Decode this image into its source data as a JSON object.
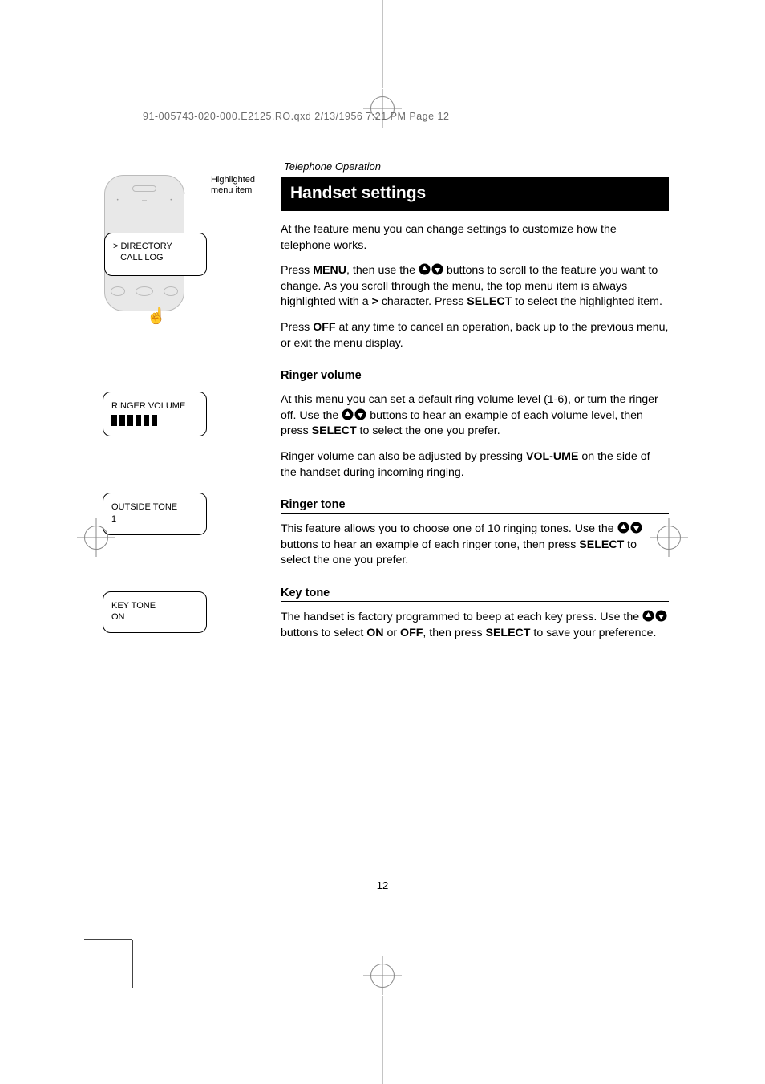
{
  "slug": "91-005743-020-000.E2125.RO.qxd  2/13/1956  7:21 PM  Page 12",
  "annot": {
    "line1": "Highlighted",
    "line2": "menu item"
  },
  "phone_screen": {
    "line1": "> DIRECTORY",
    "line2": "   CALL LOG"
  },
  "lcd_ringer": {
    "title": "RINGER VOLUME"
  },
  "lcd_outside": {
    "line1": "OUTSIDE TONE",
    "line2": "1"
  },
  "lcd_keytone": {
    "line1": "KEY TONE",
    "line2": "ON"
  },
  "section_small": "Telephone Operation",
  "title": "Handset settings",
  "intro": "At the feature menu you can change settings to customize how the telephone works.",
  "p2": {
    "a": "Press ",
    "menu": "MENU",
    "b": ", then use the ",
    "c": " buttons to scroll to the feature you want to change. As you scroll through the menu, the top menu item is always highlighted with a ",
    "gt": ">",
    "d": " character. Press ",
    "select": "SELECT",
    "e": " to select the highlighted item."
  },
  "p3": {
    "a": "Press ",
    "off": "OFF",
    "b": " at any time to cancel an operation, back up to the previous menu, or exit the menu display."
  },
  "ringer_vol": {
    "heading": "Ringer volume",
    "p1a": "At this menu you can set a default ring volume level (1-6), or turn the ringer off. Use the ",
    "p1b": " buttons to hear an example of each volume level, then press ",
    "select": "SELECT",
    "p1c": " to select the one you prefer.",
    "p2a": "Ringer volume can also be adjusted by pressing ",
    "volume": "VOL-UME",
    "p2b": " on the side of the handset during incoming ringing."
  },
  "ringer_tone": {
    "heading": "Ringer tone",
    "p1a": "This feature allows you to choose one of 10 ringing tones. Use the ",
    "p1b": " buttons to hear an example of each ringer tone, then press ",
    "select": "SELECT",
    "p1c": " to select the one you prefer."
  },
  "key_tone": {
    "heading": "Key tone",
    "p1a": "The handset is factory programmed to beep at each key press. Use the ",
    "p1b": " buttons to select ",
    "on": "ON",
    "or": " or ",
    "off": "OFF",
    "p1c": ", then press ",
    "select": "SELECT",
    "p1d": " to save your preference."
  },
  "page_num": "12"
}
